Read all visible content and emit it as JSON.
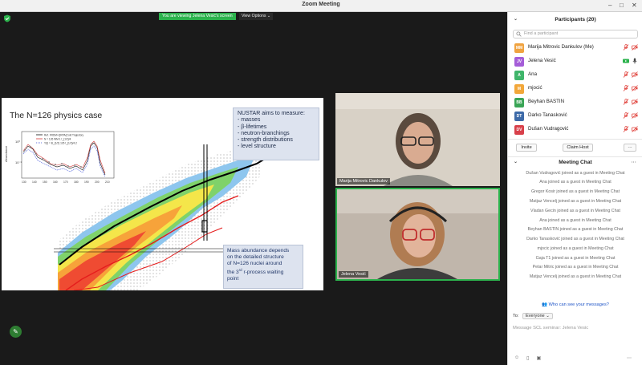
{
  "window": {
    "title": "Zoom Meeting",
    "minimize": "–",
    "maximize": "□",
    "close": "✕"
  },
  "share": {
    "banner": "You are viewing Jelena Vesić's screen",
    "view_options": "View Options ⌄"
  },
  "slide": {
    "title": "The N=126 physics case",
    "nustar_lines": [
      "NUSTAR  aims to measure:",
      "- masses",
      "- β-lifetimes",
      "- neutron-branchings",
      "- strength distributions",
      "- level structure"
    ],
    "mass_line1": "Mass abundance depends",
    "mass_line2": "on the detailed structure",
    "mass_line3": "of N=126 nuclei around",
    "mass_line4_pre": "the 3",
    "mass_line4_sup": "rd",
    "mass_line4_post": " r-process waiting",
    "mass_line5": "point"
  },
  "mini_chart": {
    "ylabel": "Abundance",
    "yticks": [
      "10⁰",
      "10⁻¹"
    ],
    "xticks": [
      "130",
      "140",
      "150",
      "160",
      "170",
      "180",
      "190",
      "200",
      "210"
    ],
    "legend": [
      "Ref. FRDM+QRPA(Cold Trajectory",
      "N = 126 WM-1 t_{1/2}/4",
      "Y(t) = B_{1/2} 126 t_{1/2}/4,2"
    ],
    "series_colors": [
      "#d43b3b",
      "#7a7a7a",
      "#3a4fd8",
      "#111111"
    ]
  },
  "videos": {
    "tile1_name": "Marija Mitrovic Dankulov",
    "tile2_name": "Jelena Vesić"
  },
  "participants": {
    "header": "Participants (20)",
    "search_placeholder": "Find a participant",
    "list": [
      {
        "initials": "MM",
        "color": "#f0a340",
        "name": "Marija Mitrovic Dankulov (Me)",
        "mic": "muted",
        "cam": "off"
      },
      {
        "initials": "JV",
        "color": "#a55dd8",
        "name": "Jelena Vesić",
        "mic": "on",
        "cam": "on"
      },
      {
        "initials": "A",
        "color": "#3fb56a",
        "name": "Ana",
        "mic": "muted",
        "cam": "off"
      },
      {
        "initials": "M",
        "color": "#f2a73a",
        "name": "mjocić",
        "mic": "muted",
        "cam": "off"
      },
      {
        "initials": "BB",
        "color": "#3aa556",
        "name": "Beyhan BASTIN",
        "mic": "muted",
        "cam": "off"
      },
      {
        "initials": "DT",
        "color": "#3d6aa8",
        "name": "Darko Tanasković",
        "mic": "muted",
        "cam": "off"
      },
      {
        "initials": "DV",
        "color": "#d8404a",
        "name": "Dušan Vudragović",
        "mic": "muted",
        "cam": "off"
      }
    ],
    "invite": "Invite",
    "claim_host": "Claim Host",
    "more": "···"
  },
  "chat": {
    "header": "Meeting Chat",
    "messages": [
      "Dušan Vudragović joined as a guest in Meeting Chat",
      "Ana joined as a guest in Meeting Chat",
      "Gregor Kosir joined as a guest in Meeting Chat",
      "Matjaz Vencelj joined as a guest in Meeting Chat",
      "Vladan Gecin joined as a guest in Meeting Chat",
      "Ana joined as a guest in Meeting Chat",
      "Beyhan BASTIN joined as a guest in Meeting Chat",
      "Darko Tanasković joined as a guest in Meeting Chat",
      "mjocic joined as a guest in Meeting Chat",
      "Gaja T1 joined as a guest in Meeting Chat",
      "Petar Mitric joined as a guest in Meeting Chat",
      "Matjaz Vencelj joined as a guest in Meeting Chat"
    ],
    "who_can": "Who can see your messages?",
    "to_label": "To:",
    "to_value": "Everyone ⌄",
    "placeholder": "Message SCL seminar: Jelena Vesic"
  },
  "colors": {
    "accent_green": "#2bb24c",
    "muted_red": "#e0403a",
    "link_blue": "#1f55c7"
  }
}
